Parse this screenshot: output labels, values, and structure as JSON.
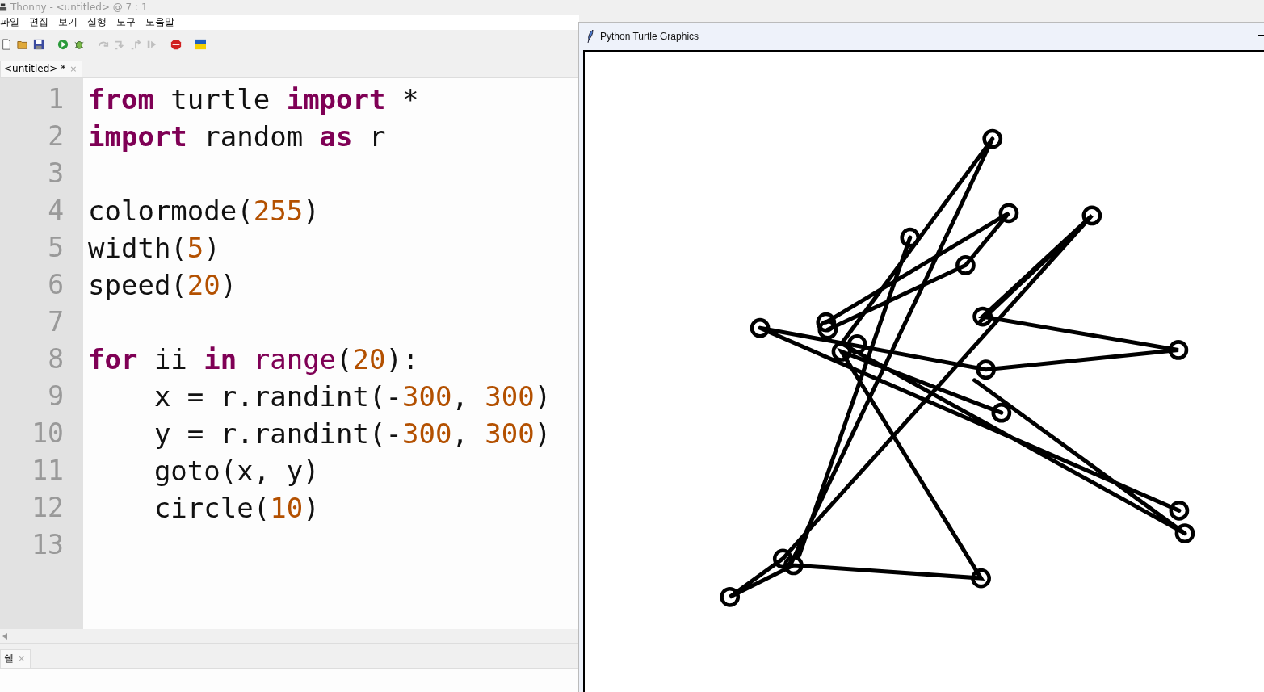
{
  "window": {
    "title": "Thonny  -  <untitled>  @  7 : 1"
  },
  "menu": [
    "파일",
    "편집",
    "보기",
    "실행",
    "도구",
    "도움말"
  ],
  "toolbar": [
    {
      "kind": "new",
      "disabled": false
    },
    {
      "kind": "open",
      "disabled": false
    },
    {
      "kind": "save",
      "disabled": false
    },
    {
      "kind": "run",
      "disabled": false
    },
    {
      "kind": "debug",
      "disabled": false
    },
    {
      "kind": "step-over",
      "disabled": true
    },
    {
      "kind": "step-into",
      "disabled": true
    },
    {
      "kind": "step-out",
      "disabled": true
    },
    {
      "kind": "resume",
      "disabled": true
    },
    {
      "kind": "stop",
      "disabled": false
    },
    {
      "kind": "flag",
      "disabled": false
    }
  ],
  "editor_tabs": [
    {
      "label": "<untitled> *",
      "close": "×",
      "selected": true
    }
  ],
  "code": [
    {
      "number": "1",
      "tokens": [
        {
          "text": "from",
          "kind": "keyword"
        },
        {
          "text": " turtle ",
          "kind": "plain"
        },
        {
          "text": "import",
          "kind": "keyword"
        },
        {
          "text": " *",
          "kind": "plain"
        }
      ]
    },
    {
      "number": "2",
      "tokens": [
        {
          "text": "import",
          "kind": "keyword"
        },
        {
          "text": " random ",
          "kind": "plain"
        },
        {
          "text": "as",
          "kind": "keyword"
        },
        {
          "text": " r",
          "kind": "plain"
        }
      ]
    },
    {
      "number": "3"
    },
    {
      "number": "4",
      "tokens": [
        {
          "text": "colormode(",
          "kind": "plain"
        },
        {
          "text": "255",
          "kind": "number"
        },
        {
          "text": ")",
          "kind": "plain"
        }
      ]
    },
    {
      "number": "5",
      "tokens": [
        {
          "text": "width(",
          "kind": "plain"
        },
        {
          "text": "5",
          "kind": "number"
        },
        {
          "text": ")",
          "kind": "plain"
        }
      ]
    },
    {
      "number": "6",
      "tokens": [
        {
          "text": "speed(",
          "kind": "plain"
        },
        {
          "text": "20",
          "kind": "number"
        },
        {
          "text": ")",
          "kind": "plain"
        }
      ]
    },
    {
      "number": "7"
    },
    {
      "number": "8",
      "tokens": [
        {
          "text": "for",
          "kind": "keyword"
        },
        {
          "text": " ii ",
          "kind": "plain"
        },
        {
          "text": "in",
          "kind": "keyword"
        },
        {
          "text": " range",
          "kind": "builtin"
        },
        {
          "text": "(",
          "kind": "plain"
        },
        {
          "text": "20",
          "kind": "number"
        },
        {
          "text": "):",
          "kind": "plain"
        }
      ]
    },
    {
      "number": "9",
      "tokens": [
        {
          "text": "    x = r.randint(-",
          "kind": "plain"
        },
        {
          "text": "300",
          "kind": "number"
        },
        {
          "text": ", ",
          "kind": "plain"
        },
        {
          "text": "300",
          "kind": "number"
        },
        {
          "text": ")",
          "kind": "plain"
        }
      ]
    },
    {
      "number": "10",
      "tokens": [
        {
          "text": "    y = r.randint(-",
          "kind": "plain"
        },
        {
          "text": "300",
          "kind": "number"
        },
        {
          "text": ", ",
          "kind": "plain"
        },
        {
          "text": "300",
          "kind": "number"
        },
        {
          "text": ")",
          "kind": "plain"
        }
      ]
    },
    {
      "number": "11",
      "tokens": [
        {
          "text": "    goto(x, y)",
          "kind": "plain"
        }
      ]
    },
    {
      "number": "12",
      "tokens": [
        {
          "text": "    circle(",
          "kind": "plain"
        },
        {
          "text": "10",
          "kind": "number"
        },
        {
          "text": ")",
          "kind": "plain"
        }
      ]
    },
    {
      "number": "13"
    }
  ],
  "shell_tabs": [
    {
      "label": "쉘",
      "close": "×",
      "selected": true
    }
  ],
  "turtle_window": {
    "title": "Python Turtle Graphics"
  }
}
